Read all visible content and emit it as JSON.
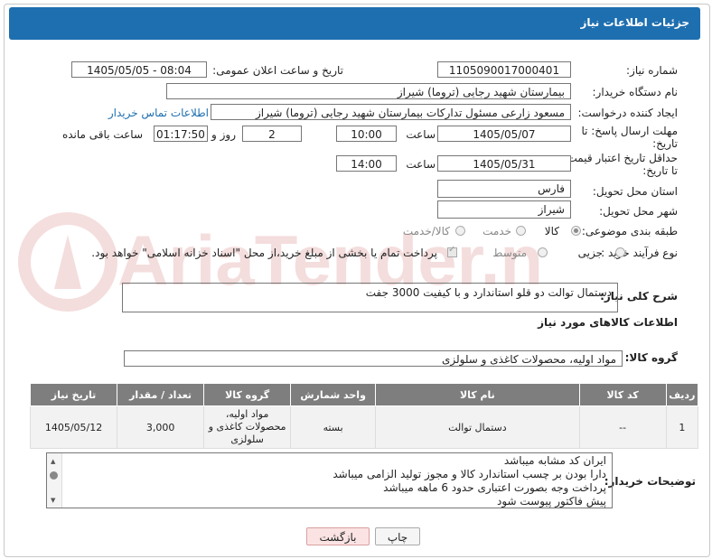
{
  "header": {
    "title": "جزئیات اطلاعات نیاز"
  },
  "watermark": {
    "text": "AriaTender.net"
  },
  "fields": {
    "need_number": {
      "label": "شماره نیاز:",
      "value": "1105090017000401"
    },
    "announce_date": {
      "label": "تاریخ و ساعت اعلان عمومی:",
      "value": "1405/05/05 - 08:04"
    },
    "buyer_org": {
      "label": "نام دستگاه خریدار:",
      "value": "بیمارستان شهید رجایی (تروما) شیراز"
    },
    "requester": {
      "label": "ایجاد کننده درخواست:",
      "value": "مسعود زارعی مسئول تدارکات بیمارستان شهید رجایی (تروما) شیراز",
      "contact_link": "اطلاعات تماس خریدار"
    },
    "reply_deadline": {
      "label_line1": "مهلت ارسال پاسخ: تا",
      "label_line2": "تاریخ:",
      "date": "1405/05/07",
      "time_label": "ساعت",
      "time": "10:00",
      "days": "2",
      "days_label": "روز و",
      "remaining": "01:17:50",
      "remaining_label": "ساعت باقی مانده"
    },
    "price_validity": {
      "label_line1": "حداقل تاریخ اعتبار قیمت:",
      "label_line2": "تا تاریخ:",
      "date": "1405/05/31",
      "time_label": "ساعت",
      "time": "14:00"
    },
    "delivery_province": {
      "label": "استان محل تحویل:",
      "value": "فارس"
    },
    "delivery_city": {
      "label": "شهر محل تحویل:",
      "value": "شیراز"
    },
    "category": {
      "label": "طبقه بندی موضوعی:",
      "options": [
        "کالا",
        "خدمت",
        "کالا/خدمت"
      ],
      "selected": "کالا"
    },
    "process_type": {
      "label": "نوع فرآیند خرید :",
      "options": [
        "جزیی",
        "متوسط"
      ],
      "note": "پرداخت تمام یا بخشی از مبلغ خرید،از محل \"اسناد خزانه اسلامی\" خواهد بود."
    }
  },
  "description": {
    "label": "شرح کلی نیاز:",
    "value": "دستمال توالت دو قلو استاندارد و با کیفیت 3000 جفت"
  },
  "goods_info": {
    "title": "اطلاعات کالاهای مورد نیاز"
  },
  "goods_group": {
    "label": "گروه کالا:",
    "value": "مواد اولیه، محصولات کاغذی و سلولزی"
  },
  "table": {
    "headers": [
      "ردیف",
      "کد کالا",
      "نام کالا",
      "واحد شمارش",
      "گروه کالا",
      "تعداد / مقدار",
      "تاریخ نیاز"
    ],
    "rows": [
      {
        "index": "1",
        "code": "--",
        "name": "دستمال توالت",
        "unit": "بسته",
        "group": "مواد اولیه، محصولات کاغذی و سلولزی",
        "qty": "3,000",
        "date": "1405/05/12"
      }
    ]
  },
  "buyer_notes": {
    "label": "توضیحات خریدار:",
    "lines": [
      "ایران کد مشابه میباشد",
      "دارا بودن بر چسب استاندارد کالا و مجوز تولید الزامی میباشد",
      "پرداخت وجه بصورت اعتباری حدود 6  ماهه میباشد",
      "پیش فاکتور پیوست شود"
    ]
  },
  "buttons": {
    "print": "چاپ",
    "back": "بازگشت"
  }
}
